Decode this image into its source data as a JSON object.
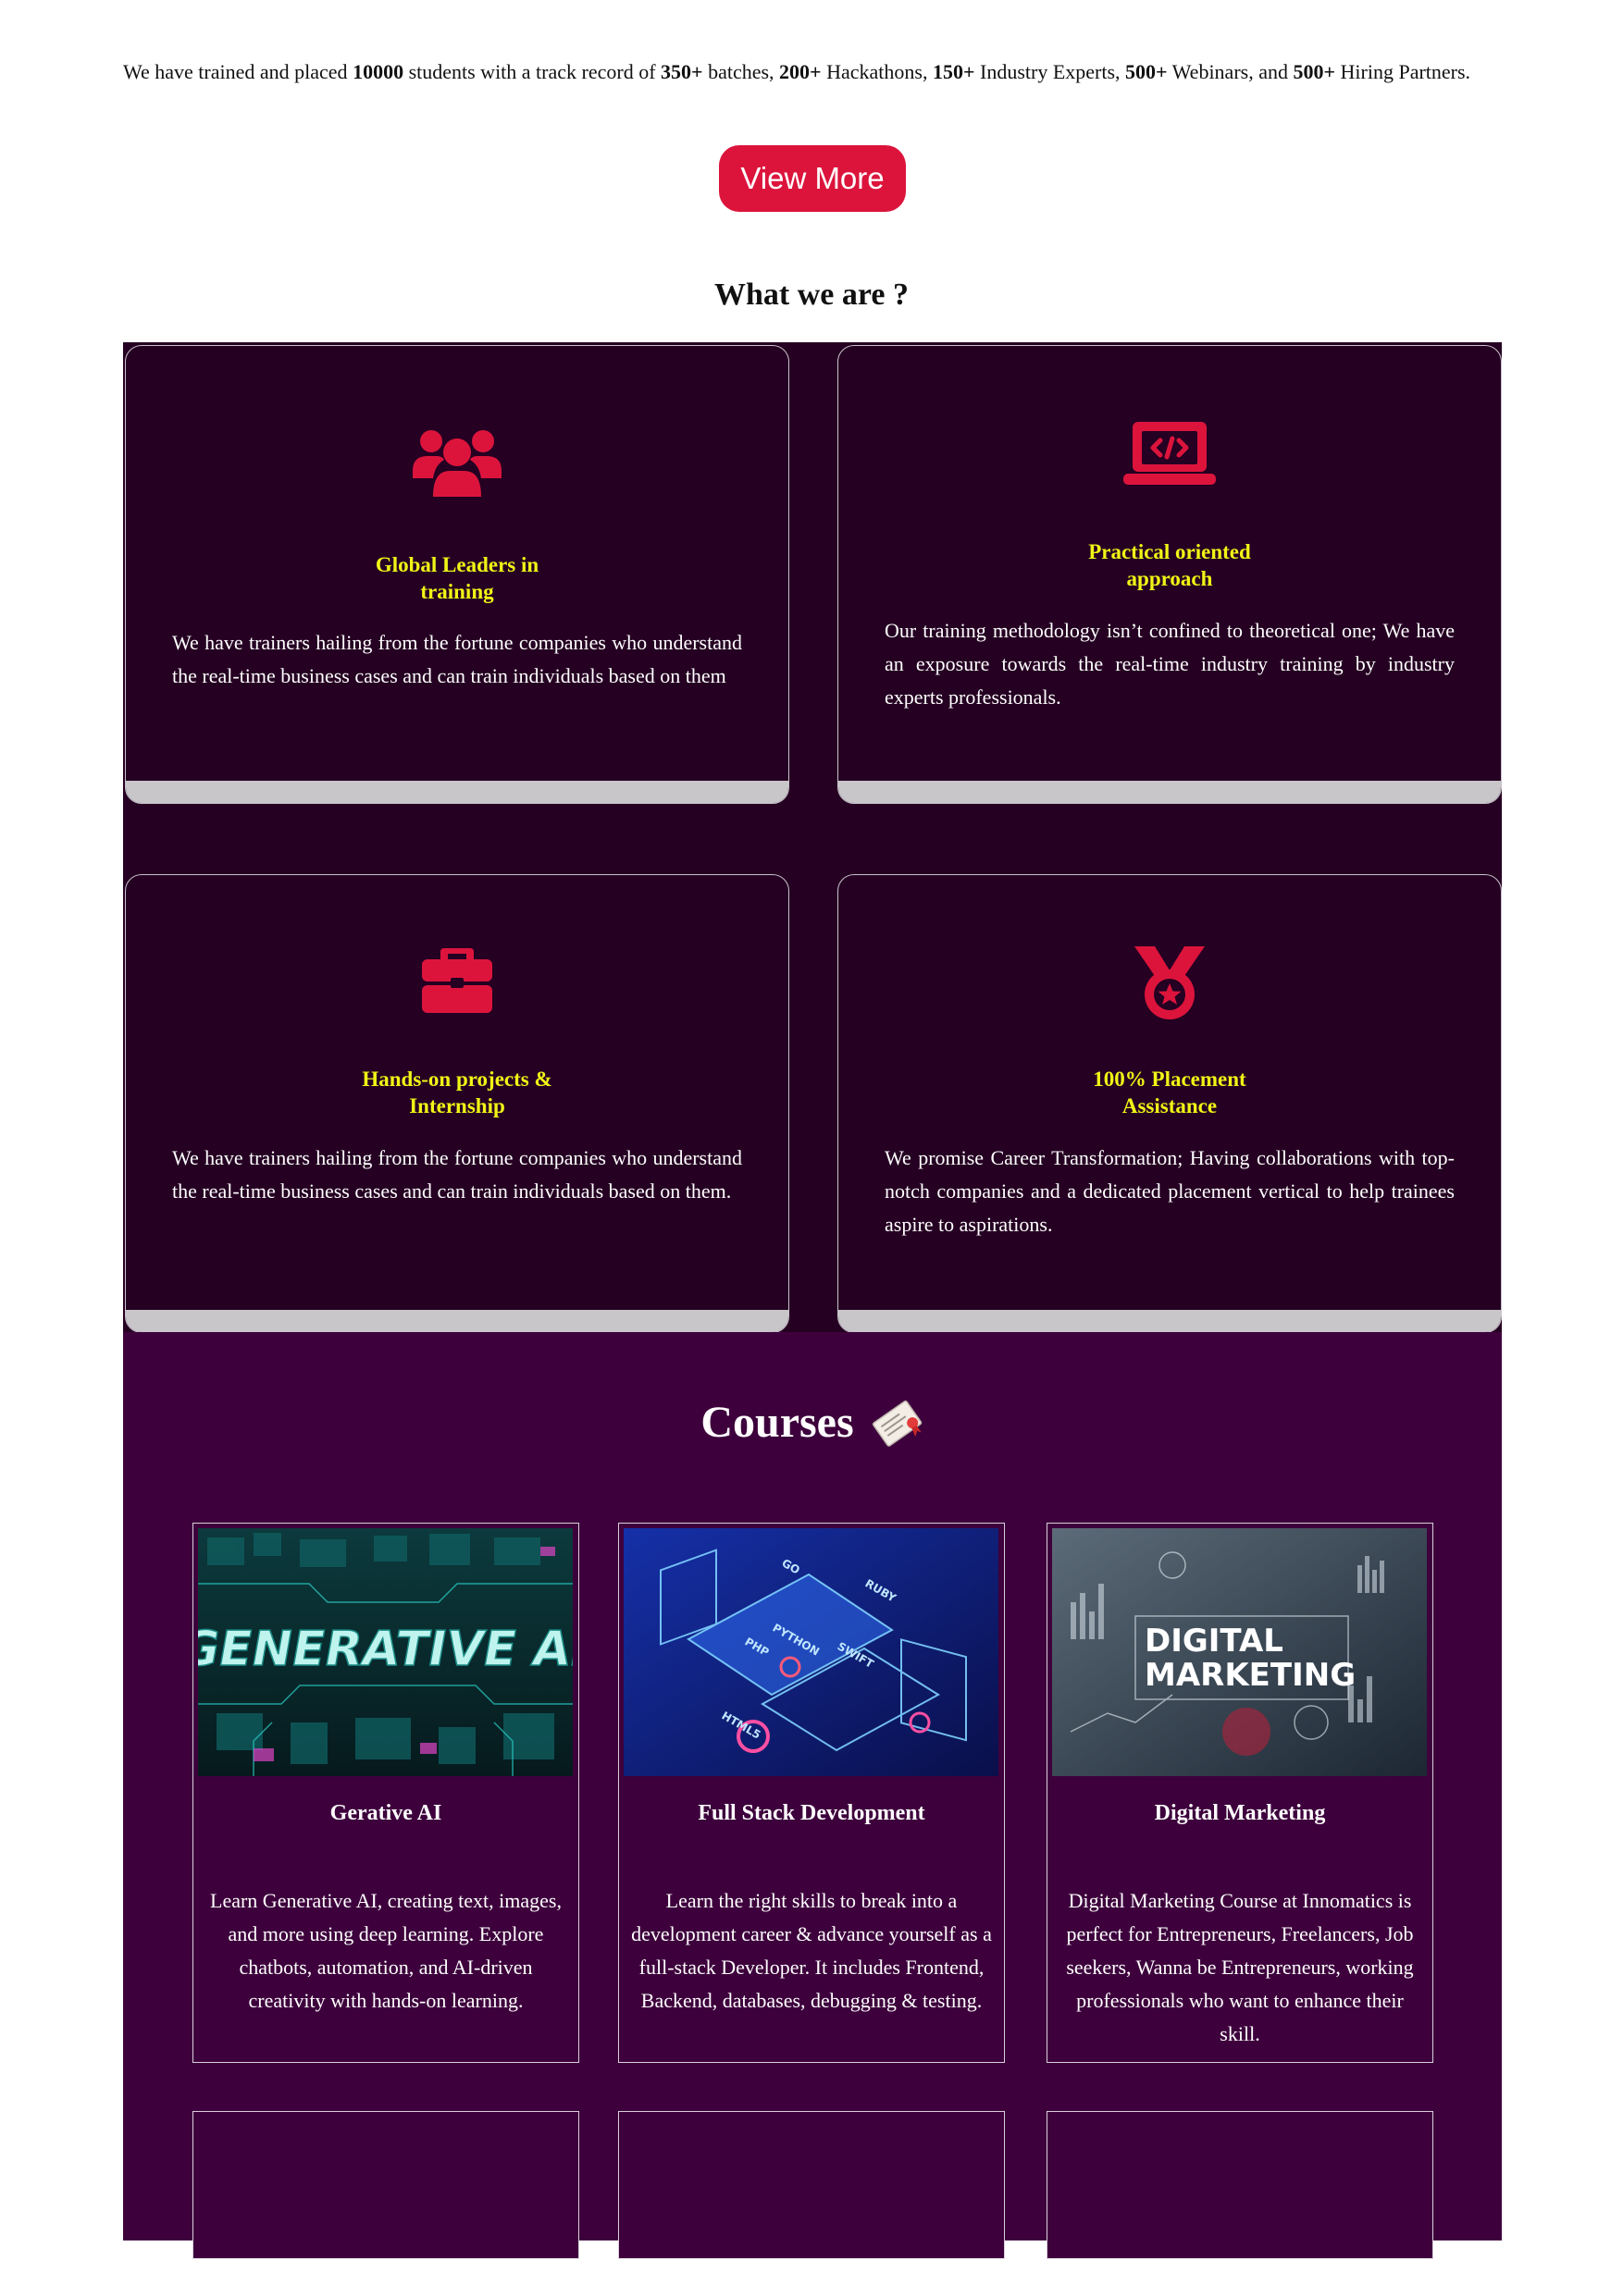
{
  "intro": {
    "parts": [
      {
        "t": "We have trained and placed ",
        "b": false
      },
      {
        "t": "10000",
        "b": true
      },
      {
        "t": " students with a track record of ",
        "b": false
      },
      {
        "t": "350+",
        "b": true
      },
      {
        "t": " batches, ",
        "b": false
      },
      {
        "t": "200+",
        "b": true
      },
      {
        "t": " Hackathons, ",
        "b": false
      },
      {
        "t": "150+",
        "b": true
      },
      {
        "t": " Industry Experts, ",
        "b": false
      },
      {
        "t": "500+",
        "b": true
      },
      {
        "t": " Webinars, and ",
        "b": false
      },
      {
        "t": "500+",
        "b": true
      },
      {
        "t": " Hiring Partners.",
        "b": false
      }
    ]
  },
  "view_more_label": "View More",
  "what_we_are": {
    "title": "What we are ?",
    "cards": [
      {
        "icon": "users-icon",
        "title_lines": [
          "Global Leaders in",
          "training"
        ],
        "text": "We have trainers hailing from the fortune companies who understand the real-time business cases and can train individuals based on them"
      },
      {
        "icon": "laptop-code-icon",
        "title_lines": [
          "Practical oriented",
          "approach"
        ],
        "text": "Our training methodology isn’t confined to theoretical one; We have an exposure towards the real-time industry training by industry experts professionals."
      },
      {
        "icon": "briefcase-icon",
        "title_lines": [
          "Hands-on projects &",
          "Internship"
        ],
        "text": "We have trainers hailing from the fortune companies who understand the real-time business cases and can train individuals based on them."
      },
      {
        "icon": "medal-icon",
        "title_lines": [
          "100% Placement",
          "Assistance"
        ],
        "text": "We promise Career Transformation; Having collaborations with top-notch companies and a dedicated placement vertical to help trainees aspire to aspirations."
      }
    ]
  },
  "courses": {
    "title": "Courses",
    "items": [
      {
        "image_text": "GENERATIVE AI",
        "name": "Gerative AI",
        "description": "Learn Generative AI, creating text, images, and more using deep learning. Explore chatbots, automation, and AI-driven creativity with hands-on learning."
      },
      {
        "image_labels": [
          "RUBY",
          "PYTHON",
          "SWIFT",
          "PHP",
          "HTML5",
          "GO"
        ],
        "name": "Full Stack Development",
        "description": "Learn the right skills to break into a development career & advance yourself as a full-stack Developer. It includes Frontend, Backend, databases, debugging & testing."
      },
      {
        "image_text_lines": [
          "DIGITAL",
          "MARKETING"
        ],
        "name": "Digital Marketing",
        "description": "Digital Marketing Course at Innomatics is perfect for Entrepreneurs, Freelancers, Job seekers, Wanna be Entrepreneurs, working professionals who want to enhance their skill."
      }
    ]
  },
  "colors": {
    "accent": "#dc143c",
    "card_bg": "#250022",
    "courses_bg": "#3d003c",
    "heading_yellow": "#f1f516"
  }
}
